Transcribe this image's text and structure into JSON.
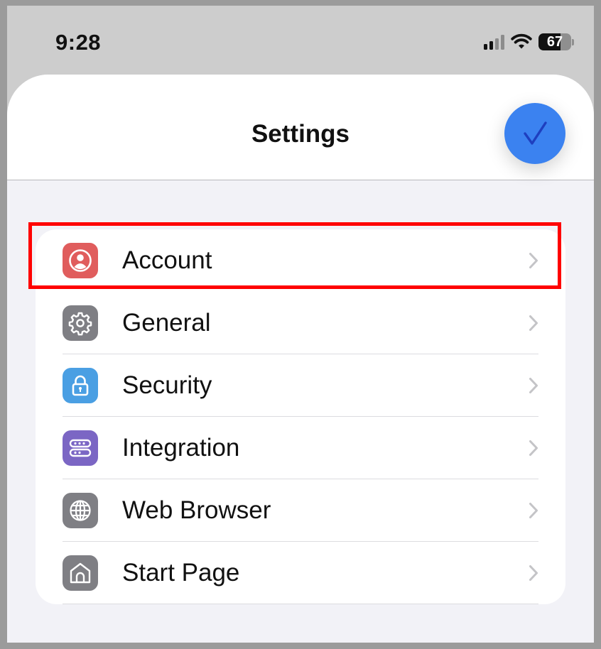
{
  "status_bar": {
    "time": "9:28",
    "battery_level": "67",
    "battery_fraction": 0.67,
    "signal_bars_active": 2,
    "signal_bars_total": 4,
    "icons": [
      "cellular-signal-icon",
      "wifi-icon",
      "battery-icon"
    ]
  },
  "sheet": {
    "title": "Settings",
    "done_button_icon": "checkmark-icon"
  },
  "settings_list": {
    "highlighted_item": "Account",
    "highlight_color": "#ff0000",
    "items": [
      {
        "label": "Account",
        "icon": "person-circle-icon",
        "color": "#e05d5d"
      },
      {
        "label": "General",
        "icon": "gear-icon",
        "color": "#7f7f84"
      },
      {
        "label": "Security",
        "icon": "lock-icon",
        "color": "#4a9fe3"
      },
      {
        "label": "Integration",
        "icon": "server-rack-icon",
        "color": "#7b66c4"
      },
      {
        "label": "Web Browser",
        "icon": "globe-icon",
        "color": "#7f7f84"
      },
      {
        "label": "Start Page",
        "icon": "home-icon",
        "color": "#7f7f84"
      }
    ]
  },
  "colors": {
    "accent": "#3b82f0",
    "chevron": "#c4c4c7"
  }
}
